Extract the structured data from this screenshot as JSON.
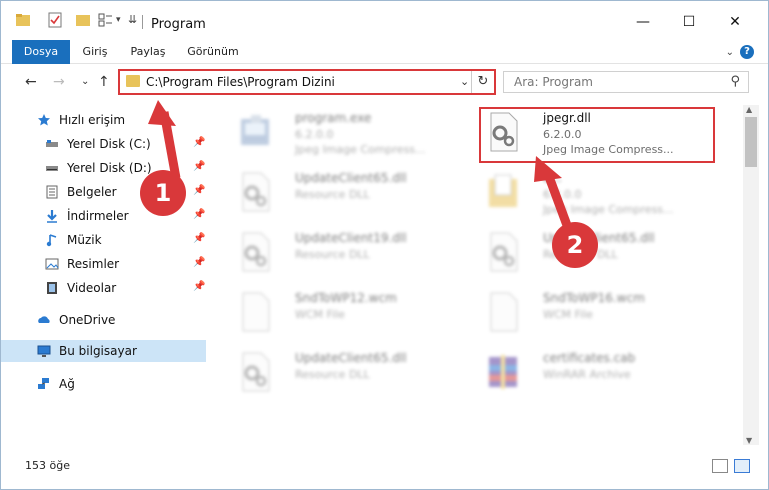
{
  "window": {
    "title": "Program",
    "controls": {
      "minimize": "—",
      "maximize": "☐",
      "close": "✕"
    }
  },
  "ribbon": {
    "tabs": [
      "Dosya",
      "Giriş",
      "Paylaş",
      "Görünüm"
    ],
    "expand_icon": "chevron-down",
    "help_label": "?"
  },
  "nav": {
    "back": "←",
    "forward": "→",
    "recent": "⌄",
    "up": "↑",
    "address": "C:\\Program Files\\Program Dizini",
    "dropdown_glyph": "⌄",
    "refresh_glyph": "↻",
    "search_placeholder": "Ara: Program",
    "search_glyph": "⚲"
  },
  "sidebar": {
    "quick_access": "Hızlı erişim",
    "items": [
      {
        "label": "Yerel Disk (C:)",
        "icon": "drive-icon"
      },
      {
        "label": "Yerel Disk (D:)",
        "icon": "drive-icon"
      },
      {
        "label": "Belgeler",
        "icon": "documents-icon"
      },
      {
        "label": "İndirmeler",
        "icon": "downloads-icon"
      },
      {
        "label": "Müzik",
        "icon": "music-icon"
      },
      {
        "label": "Resimler",
        "icon": "pictures-icon"
      },
      {
        "label": "Videolar",
        "icon": "videos-icon"
      }
    ],
    "onedrive": "OneDrive",
    "this_pc": "Bu bilgisayar",
    "network": "Ağ",
    "pin_glyph": "📌"
  },
  "files": [
    {
      "name": "program.exe",
      "line1": "6.2.0.0",
      "line2": "Jpeg Image Compress...",
      "icon": "exe-icon",
      "blurred": true
    },
    {
      "name": "jpegr.dll",
      "line1": "6.2.0.0",
      "line2": "Jpeg Image Compress...",
      "icon": "dll-gear-icon",
      "blurred": false
    },
    {
      "name": "UpdateClient65.dll",
      "line1": "Resource DLL",
      "line2": "",
      "icon": "dll-gear-icon",
      "blurred": true
    },
    {
      "name": "e...",
      "line1": "6.2.0.0",
      "line2": "Jpeg Image Compress...",
      "icon": "folder-doc-icon",
      "blurred": true
    },
    {
      "name": "UpdateClient19.dll",
      "line1": "Resource DLL",
      "line2": "",
      "icon": "dll-gear-icon",
      "blurred": true
    },
    {
      "name": "UpdateClient65.dll",
      "line1": "Resource DLL",
      "line2": "",
      "icon": "dll-gear-icon",
      "blurred": true
    },
    {
      "name": "SndToWP12.wcm",
      "line1": "WCM File",
      "line2": "",
      "icon": "blank-file-icon",
      "blurred": true
    },
    {
      "name": "SndToWP16.wcm",
      "line1": "WCM File",
      "line2": "",
      "icon": "blank-file-icon",
      "blurred": true
    },
    {
      "name": "UpdateClient65.dll",
      "line1": "Resource DLL",
      "line2": "",
      "icon": "dll-gear-icon",
      "blurred": true
    },
    {
      "name": "certificates.cab",
      "line1": "WinRAR Archive",
      "line2": "",
      "icon": "archive-icon",
      "blurred": true
    }
  ],
  "status": {
    "count": "153 öğe"
  },
  "annotations": {
    "step1": "1",
    "step2": "2"
  },
  "colors": {
    "accent": "#1a6fbd",
    "highlight": "#d9383a",
    "selected": "#cce4f7"
  }
}
